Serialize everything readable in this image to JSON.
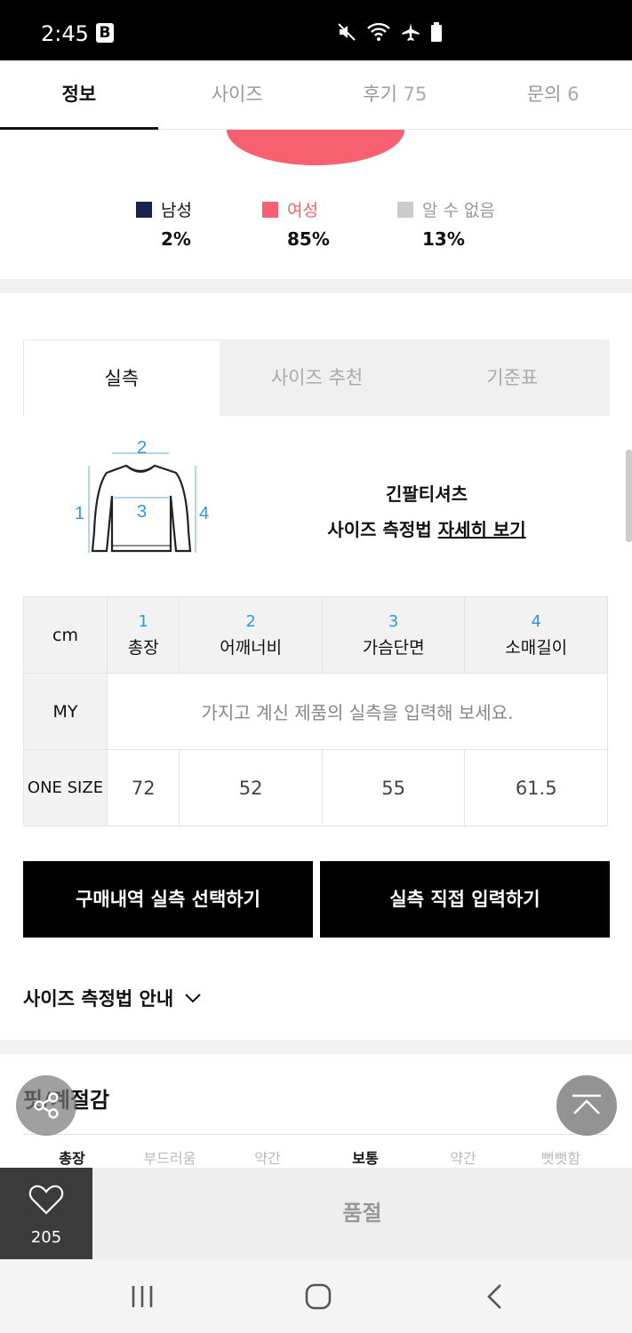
{
  "status_bar": {
    "time": "2:45",
    "app_badge": "B",
    "icons": [
      "mute-icon",
      "wifi-icon",
      "airplane-icon",
      "battery-icon"
    ]
  },
  "tabs": [
    {
      "label": "정보",
      "count": "",
      "active": true
    },
    {
      "label": "사이즈",
      "count": "",
      "active": false
    },
    {
      "label": "후기",
      "count": "75",
      "active": false
    },
    {
      "label": "문의",
      "count": "6",
      "active": false
    }
  ],
  "gender_chart": {
    "colors": {
      "male": "#1b2150",
      "female": "#f7616f",
      "unknown": "#cccccc"
    },
    "items": [
      {
        "label": "남성",
        "percent": "2%"
      },
      {
        "label": "여성",
        "percent": "85%"
      },
      {
        "label": "알 수 없음",
        "percent": "13%"
      }
    ]
  },
  "sub_tabs": [
    {
      "label": "실측",
      "active": true
    },
    {
      "label": "사이즈 추천",
      "active": false
    },
    {
      "label": "기준표",
      "active": false
    }
  ],
  "measure_guide": {
    "product_type": "긴팔티셔츠",
    "method_label": "사이즈 측정법",
    "detail_link": "자세히 보기",
    "diagram_numbers": [
      "1",
      "2",
      "3",
      "4"
    ]
  },
  "size_table": {
    "unit": "cm",
    "columns": [
      {
        "num": "1",
        "label": "총장"
      },
      {
        "num": "2",
        "label": "어깨너비"
      },
      {
        "num": "3",
        "label": "가슴단면"
      },
      {
        "num": "4",
        "label": "소매길이"
      }
    ],
    "my_row": {
      "label": "MY",
      "placeholder": "가지고 계신 제품의 실측을 입력해 보세요."
    },
    "rows": [
      {
        "label": "ONE SIZE",
        "values": [
          "72",
          "52",
          "55",
          "61.5"
        ]
      }
    ]
  },
  "buttons": {
    "purchase_select": "구매내역 실측 선택하기",
    "direct_input": "실측 직접 입력하기"
  },
  "size_guide_label": "사이즈 측정법 안내",
  "fit_section": {
    "title": "핏/계절감",
    "row_partial": [
      "총장",
      "부드러움",
      "약간",
      "보통",
      "약간",
      "뻣뻣함"
    ]
  },
  "bottom_bar": {
    "like_count": "205",
    "sold_out": "품절"
  }
}
